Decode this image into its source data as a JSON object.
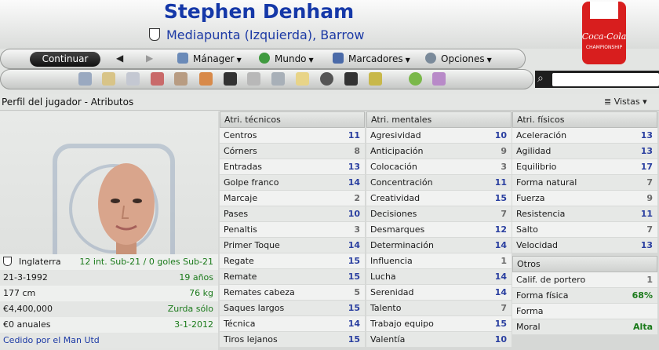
{
  "header": {
    "player_name": "Stephen Denham",
    "subtitle": "Mediapunta (Izquierda), Barrow",
    "competition_logo_text": "Coca-Cola CHAMPIONSHIP"
  },
  "menu": {
    "continue_label": "Continuar",
    "back_icon": "triangle-left-icon",
    "forward_icon": "triangle-right-icon",
    "items": [
      {
        "label": "Mánager",
        "icon": "manager-icon"
      },
      {
        "label": "Mundo",
        "icon": "globe-icon"
      },
      {
        "label": "Marcadores",
        "icon": "bookmarks-icon"
      },
      {
        "label": "Opciones",
        "icon": "options-gear-icon"
      }
    ]
  },
  "toolbar": {
    "icons": [
      "home-icon",
      "bread-icon",
      "list-icon",
      "calendar-icon",
      "people-icon",
      "transfer-icon",
      "tactics-icon",
      "trophy-icon",
      "scout-icon",
      "clipboard-icon",
      "ball-icon",
      "binoculars-icon",
      "money-icon",
      "help-icon",
      "question-icon"
    ],
    "search_icon": "magnifier-icon",
    "search_placeholder": ""
  },
  "page": {
    "title": "Perfil del jugador - Atributos",
    "views_label": "Vistas"
  },
  "info": [
    {
      "left": "Inglaterra",
      "right": "12 int. Sub-21 / 0 goles Sub-21"
    },
    {
      "left": "21-3-1992",
      "right": "19 años"
    },
    {
      "left": "177 cm",
      "right": "76 kg"
    },
    {
      "left": "€4,400,000",
      "right": "Zurda sólo"
    },
    {
      "left": "€0 anuales",
      "right": "3-1-2012"
    },
    {
      "left": "Cedido por el Man Utd",
      "right": ""
    }
  ],
  "technical": {
    "title": "Atri. técnicos",
    "rows": [
      {
        "label": "Centros",
        "value": "11"
      },
      {
        "label": "Córners",
        "value": "8"
      },
      {
        "label": "Entradas",
        "value": "13"
      },
      {
        "label": "Golpe franco",
        "value": "14"
      },
      {
        "label": "Marcaje",
        "value": "2"
      },
      {
        "label": "Pases",
        "value": "10"
      },
      {
        "label": "Penaltis",
        "value": "3"
      },
      {
        "label": "Primer Toque",
        "value": "14"
      },
      {
        "label": "Regate",
        "value": "15"
      },
      {
        "label": "Remate",
        "value": "15"
      },
      {
        "label": "Remates cabeza",
        "value": "5"
      },
      {
        "label": "Saques largos",
        "value": "15"
      },
      {
        "label": "Técnica",
        "value": "14"
      },
      {
        "label": "Tiros lejanos",
        "value": "15"
      }
    ]
  },
  "mental": {
    "title": "Atri. mentales",
    "rows": [
      {
        "label": "Agresividad",
        "value": "10"
      },
      {
        "label": "Anticipación",
        "value": "9"
      },
      {
        "label": "Colocación",
        "value": "3"
      },
      {
        "label": "Concentración",
        "value": "11"
      },
      {
        "label": "Creatividad",
        "value": "15"
      },
      {
        "label": "Decisiones",
        "value": "7"
      },
      {
        "label": "Desmarques",
        "value": "12"
      },
      {
        "label": "Determinación",
        "value": "14"
      },
      {
        "label": "Influencia",
        "value": "1"
      },
      {
        "label": "Lucha",
        "value": "14"
      },
      {
        "label": "Serenidad",
        "value": "14"
      },
      {
        "label": "Talento",
        "value": "7"
      },
      {
        "label": "Trabajo equipo",
        "value": "15"
      },
      {
        "label": "Valentía",
        "value": "10"
      }
    ]
  },
  "physical": {
    "title": "Atri. físicos",
    "rows": [
      {
        "label": "Aceleración",
        "value": "13"
      },
      {
        "label": "Agilidad",
        "value": "13"
      },
      {
        "label": "Equilibrio",
        "value": "17"
      },
      {
        "label": "Forma natural",
        "value": "7"
      },
      {
        "label": "Fuerza",
        "value": "9"
      },
      {
        "label": "Resistencia",
        "value": "11"
      },
      {
        "label": "Salto",
        "value": "7"
      },
      {
        "label": "Velocidad",
        "value": "13"
      }
    ]
  },
  "other": {
    "title": "Otros",
    "rows": [
      {
        "label": "Calif. de portero",
        "value": "1"
      },
      {
        "label": "Forma física",
        "value": "68%"
      },
      {
        "label": "Forma",
        "value": ""
      },
      {
        "label": "Moral",
        "value": "Alta"
      }
    ]
  },
  "colors": {
    "value_low": "#6b6b6b",
    "value_mid": "#2a3fa0",
    "value_high": "#1c2f8e",
    "green": "#1a7a1a"
  }
}
